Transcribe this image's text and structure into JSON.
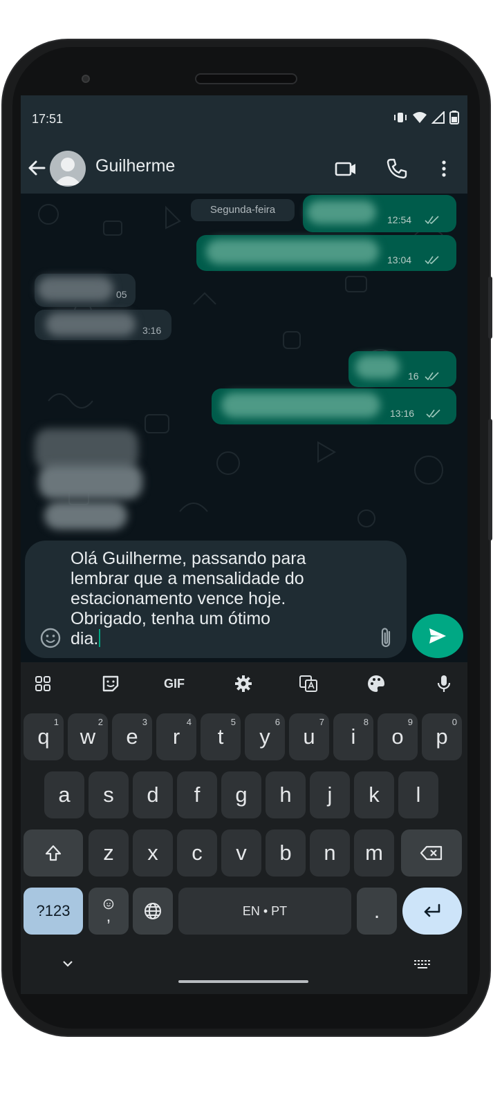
{
  "status_bar": {
    "time": "17:51"
  },
  "header": {
    "contact_name": "Guilherme"
  },
  "chat": {
    "date_separator": "Segunda-feira",
    "messages": [
      {
        "direction": "out",
        "time": "12:54"
      },
      {
        "direction": "out",
        "time": "13:04"
      },
      {
        "direction": "in",
        "time": "05"
      },
      {
        "direction": "in",
        "time": "3:16"
      },
      {
        "direction": "out",
        "time": "16"
      },
      {
        "direction": "out",
        "time": "13:16"
      }
    ]
  },
  "composer": {
    "text": "Olá Guilherme, passando para\nlembrar que a mensalidade do\nestacionamento vence hoje.\nObrigado, tenha um ótimo\ndia."
  },
  "keyboard": {
    "toolbar": {
      "gif_label": "GIF"
    },
    "row1": [
      {
        "key": "q",
        "hint": "1"
      },
      {
        "key": "w",
        "hint": "2"
      },
      {
        "key": "e",
        "hint": "3"
      },
      {
        "key": "r",
        "hint": "4"
      },
      {
        "key": "t",
        "hint": "5"
      },
      {
        "key": "y",
        "hint": "6"
      },
      {
        "key": "u",
        "hint": "7"
      },
      {
        "key": "i",
        "hint": "8"
      },
      {
        "key": "o",
        "hint": "9"
      },
      {
        "key": "p",
        "hint": "0"
      }
    ],
    "row2": [
      "a",
      "s",
      "d",
      "f",
      "g",
      "h",
      "j",
      "k",
      "l"
    ],
    "row3": [
      "z",
      "x",
      "c",
      "v",
      "b",
      "n",
      "m"
    ],
    "symbols_label": "?123",
    "comma_label": ",",
    "space_label": "EN • PT",
    "period_label": "."
  },
  "colors": {
    "accent_green": "#00a884",
    "outgoing_bubble": "#005c4b",
    "header_bg": "#1f2c33"
  }
}
